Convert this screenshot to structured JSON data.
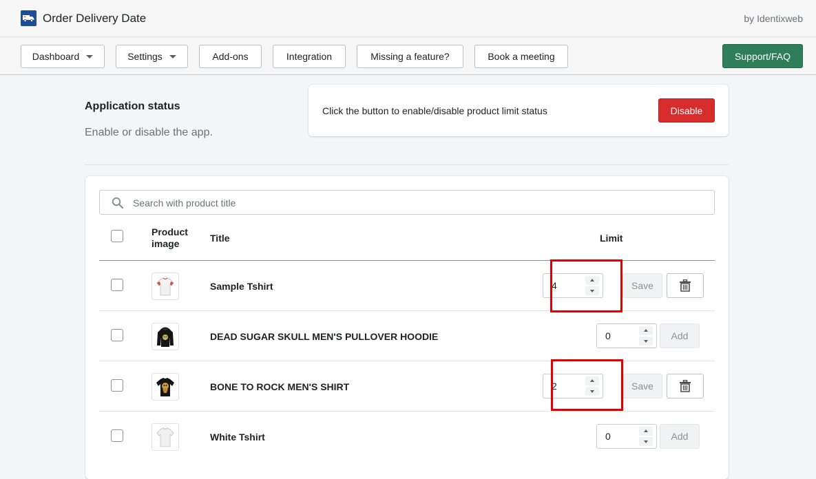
{
  "app": {
    "title": "Order Delivery Date",
    "byline": "by Identixweb"
  },
  "nav": {
    "dashboard": "Dashboard",
    "settings": "Settings",
    "addons": "Add-ons",
    "integration": "Integration",
    "missing": "Missing a feature?",
    "meeting": "Book a meeting",
    "support": "Support/FAQ",
    "support_color": "#2e7d5b"
  },
  "status": {
    "heading": "Application status",
    "description": "Enable or disable the app.",
    "message": "Click the button to enable/disable product limit status",
    "button": "Disable",
    "button_color": "#d72c2c"
  },
  "search": {
    "placeholder": "Search with product title",
    "icon": "search-icon"
  },
  "table": {
    "headers": {
      "image_line1": "Product",
      "image_line2": "image",
      "title": "Title",
      "limit": "Limit"
    },
    "rows": [
      {
        "title": "Sample Tshirt",
        "limit": "4",
        "action": "Save",
        "has_delete": true,
        "highlighted": true
      },
      {
        "title": "DEAD SUGAR SKULL MEN'S PULLOVER HOODIE",
        "limit": "0",
        "action": "Add",
        "has_delete": false,
        "highlighted": false
      },
      {
        "title": "BONE TO ROCK MEN'S SHIRT",
        "limit": "2",
        "action": "Save",
        "has_delete": true,
        "highlighted": true
      },
      {
        "title": "White Tshirt",
        "limit": "0",
        "action": "Add",
        "has_delete": false,
        "highlighted": false
      }
    ]
  },
  "highlight_color": "#e00000"
}
